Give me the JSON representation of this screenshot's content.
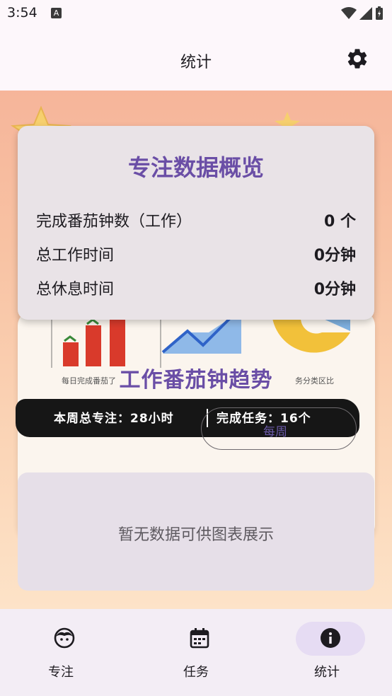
{
  "status_bar": {
    "time": "3:54",
    "notification_glyph": "A"
  },
  "app_bar": {
    "title": "统计"
  },
  "overview": {
    "title": "专注数据概览",
    "rows": [
      {
        "label": "完成番茄钟数（工作）",
        "value": "0 个"
      },
      {
        "label": "总工作时间",
        "value": "0分钟"
      },
      {
        "label": "总休息时间",
        "value": "0分钟"
      }
    ]
  },
  "illustration": {
    "caption_daily": "每日完成番茄了",
    "caption_category": "务分类区比",
    "week_total": "本周总专注：28小时",
    "tasks_done": "完成任务：16个"
  },
  "trend": {
    "title": "工作番茄钟趋势",
    "period_chip": "每周"
  },
  "empty_state": {
    "message": "暂无数据可供图表展示"
  },
  "bottom_nav": {
    "items": [
      {
        "label": "专注",
        "icon": "face-icon",
        "active": false
      },
      {
        "label": "任务",
        "icon": "calendar-icon",
        "active": false
      },
      {
        "label": "统计",
        "icon": "info-icon",
        "active": true
      }
    ]
  },
  "colors": {
    "accent": "#6a4ea6",
    "active_pill": "#e6dcf3",
    "card": "#e9e3e7"
  }
}
